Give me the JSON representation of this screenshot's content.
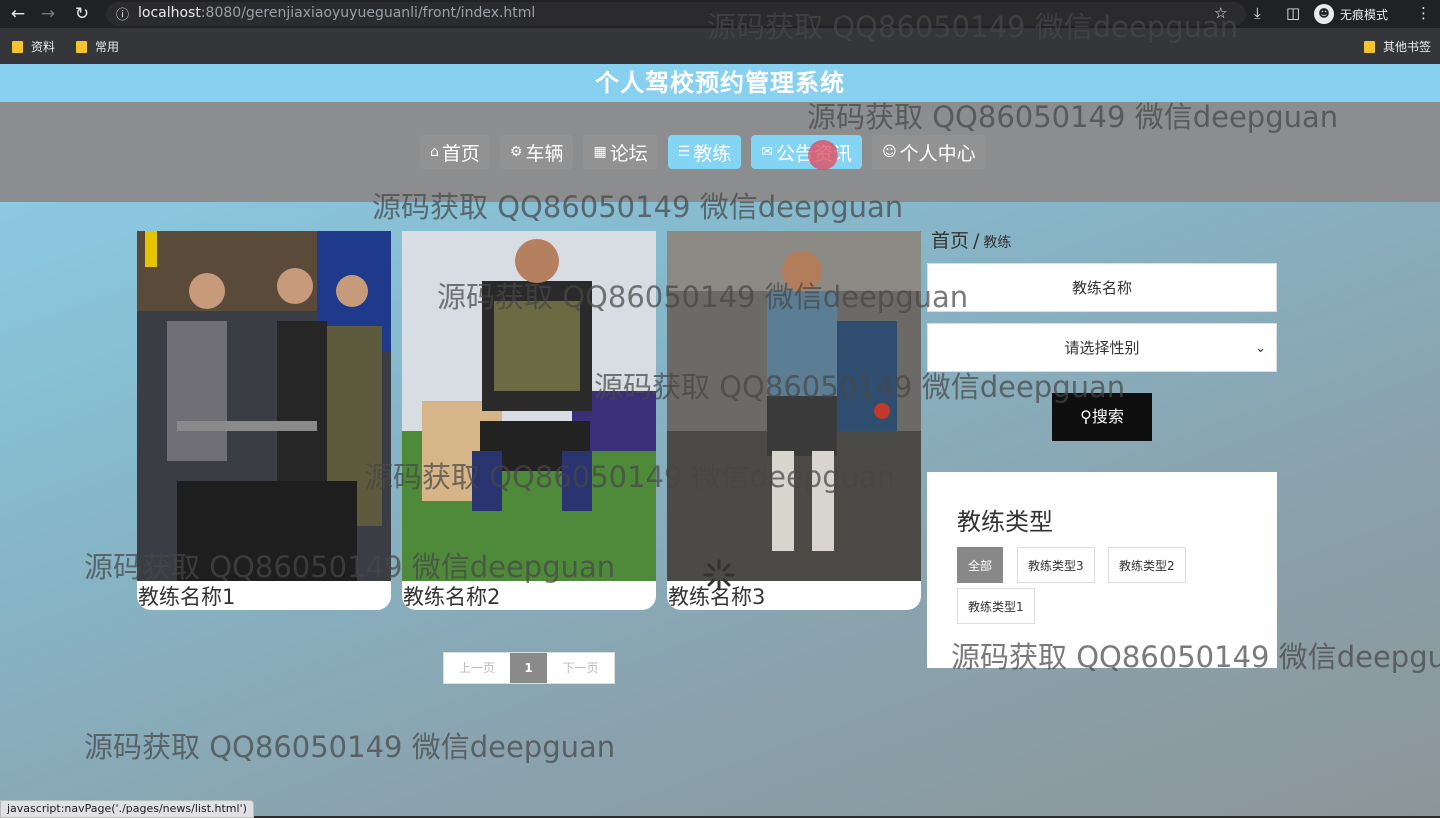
{
  "browser": {
    "url_host": "localhost",
    "url_rest": ":8080/gerenjiaxiaoyuyueguanli/front/index.html",
    "incognito_label": "无痕模式",
    "bookmarks": [
      "资料",
      "常用"
    ],
    "other_bookmarks": "其他书签",
    "status_url": "javascript:navPage('./pages/news/list.html')"
  },
  "site": {
    "title": "个人驾校预约管理系统",
    "nav": [
      {
        "label": "首页",
        "icon": "home-icon"
      },
      {
        "label": "车辆",
        "icon": "car-icon"
      },
      {
        "label": "论坛",
        "icon": "forum-icon"
      },
      {
        "label": "教练",
        "icon": "coach-icon"
      },
      {
        "label": "公告资讯",
        "icon": "mail-icon"
      },
      {
        "label": "个人中心",
        "icon": "user-icon"
      }
    ]
  },
  "breadcrumb": {
    "home": "首页",
    "sep": "/",
    "current": "教练"
  },
  "filters": {
    "name_placeholder": "教练名称",
    "gender_placeholder": "请选择性别",
    "search_label": "搜索"
  },
  "coaches": [
    {
      "name": "教练名称1"
    },
    {
      "name": "教练名称2"
    },
    {
      "name": "教练名称3"
    }
  ],
  "pagination": {
    "prev": "上一页",
    "current": "1",
    "next": "下一页"
  },
  "type_panel": {
    "title": "教练类型",
    "tags": [
      "全部",
      "教练类型3",
      "教练类型2",
      "教练类型1"
    ]
  },
  "watermark": "源码获取 QQ86050149 微信deepguan",
  "watermark_partial": "源码获取 QQ86050149 微信deepgu",
  "watermark_top": "源码获取 QQ86050149 微信deepguan"
}
